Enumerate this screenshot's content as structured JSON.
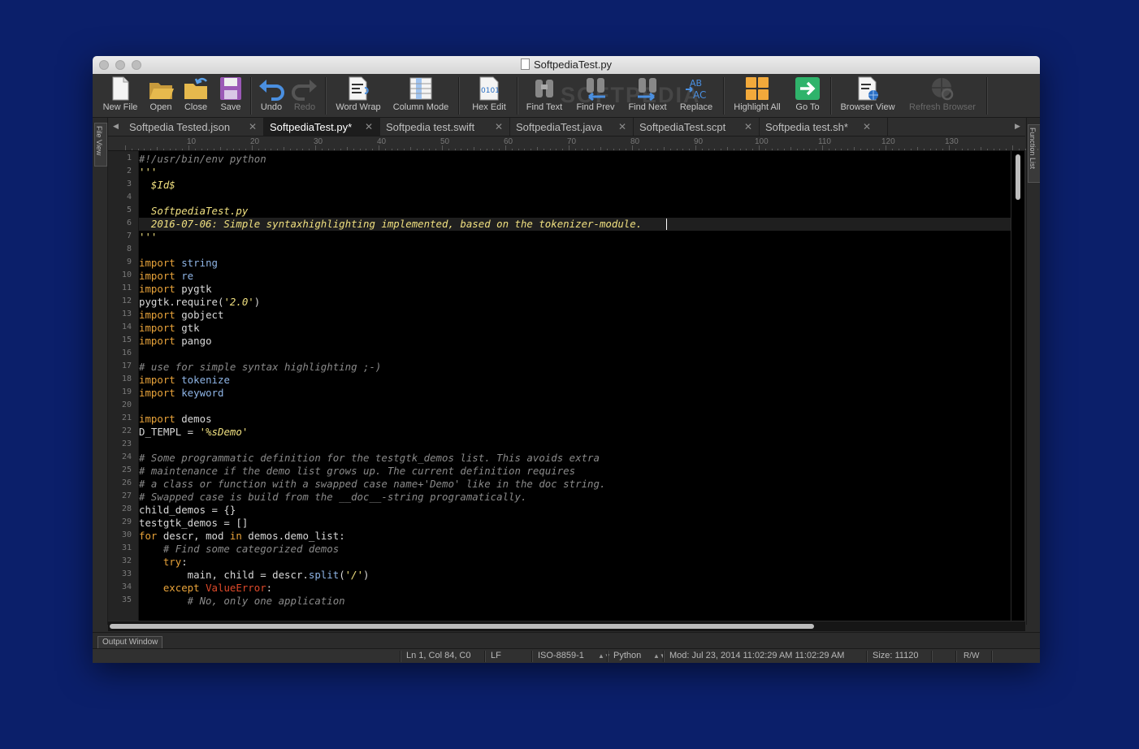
{
  "window": {
    "title": "SoftpediaTest.py"
  },
  "watermark": "SOFTPEDIA",
  "toolbar": {
    "new_file": "New File",
    "open": "Open",
    "close": "Close",
    "save": "Save",
    "undo": "Undo",
    "redo": "Redo",
    "word_wrap": "Word Wrap",
    "column_mode": "Column Mode",
    "hex_edit": "Hex Edit",
    "find_text": "Find Text",
    "find_prev": "Find Prev",
    "find_next": "Find Next",
    "replace": "Replace",
    "highlight_all": "Highlight All",
    "go_to": "Go To",
    "browser_view": "Browser View",
    "refresh_browser": "Refresh Browser"
  },
  "side_panels": {
    "left": "File View",
    "right": "Function List"
  },
  "tabs": [
    {
      "label": "Softpedia Tested.json",
      "active": false
    },
    {
      "label": "SoftpediaTest.py*",
      "active": true
    },
    {
      "label": "Softpedia test.swift",
      "active": false
    },
    {
      "label": "SoftpediaTest.java",
      "active": false
    },
    {
      "label": "SoftpediaTest.scpt",
      "active": false
    },
    {
      "label": "Softpedia test.sh*",
      "active": false
    }
  ],
  "ruler": [
    "10",
    "20",
    "30",
    "40",
    "50",
    "60",
    "70",
    "80",
    "90",
    "100",
    "110",
    "120",
    "130"
  ],
  "line_numbers": [
    "1",
    "2",
    "3",
    "4",
    "5",
    "6",
    "7",
    "8",
    "9",
    "10",
    "11",
    "12",
    "13",
    "14",
    "15",
    "16",
    "17",
    "18",
    "19",
    "20",
    "21",
    "22",
    "23",
    "24",
    "25",
    "26",
    "27",
    "28",
    "29",
    "30",
    "31",
    "32",
    "33",
    "34",
    "35"
  ],
  "code": {
    "l1": "#!/usr/bin/env python",
    "l2": "'''",
    "l3": "  $Id$",
    "l5": "  SoftpediaTest.py",
    "l6": "  2016-07-06: Simple syntaxhighlighting implemented, based on the tokenizer-module.",
    "l7": "'''",
    "kw_import": "import",
    "l9_mod": " string",
    "l10_mod": " re",
    "l11_mod": " pygtk",
    "l12_a": "pygtk.require(",
    "l12_str": "'2.0'",
    "l12_b": ")",
    "l13_mod": " gobject",
    "l14_mod": " gtk",
    "l15_mod": " pango",
    "l17": "# use for simple syntax highlighting ;-)",
    "l18_mod": " tokenize",
    "l19_mod": " keyword",
    "l21_mod": " demos",
    "l22_a": "D_TEMPL = ",
    "l22_str": "'%sDemo'",
    "l24": "# Some programmatic definition for the testgtk_demos list. This avoids extra",
    "l25": "# maintenance if the demo list grows up. The current definition requires",
    "l26": "# a class or function with a swapped case name+'Demo' like in the doc string.",
    "l27": "# Swapped case is build from the __doc__-string programatically.",
    "l28": "child_demos = {}",
    "l29": "testgtk_demos = []",
    "l30_for": "for",
    "l30_a": " descr, mod ",
    "l30_in": "in",
    "l30_b": " demos.demo_list:",
    "l31": "    # Find some categorized demos",
    "l32_try": "    try",
    "l32_b": ":",
    "l33_a": "        main, child = descr.",
    "l33_split": "split",
    "l33_b": "(",
    "l33_str": "'/'",
    "l33_c": ")",
    "l34_except": "    except",
    "l34_err": " ValueError",
    "l34_b": ":",
    "l35": "        # No, only one application"
  },
  "output_window": "Output Window",
  "status": {
    "position": "Ln 1, Col 84, C0",
    "line_ending": "LF",
    "encoding": "ISO-8859-1",
    "language": "Python",
    "modified": "Mod: Jul 23, 2014 11:02:29 AM 11:02:29 AM",
    "size": "Size: 11120",
    "mode": "R/W"
  }
}
